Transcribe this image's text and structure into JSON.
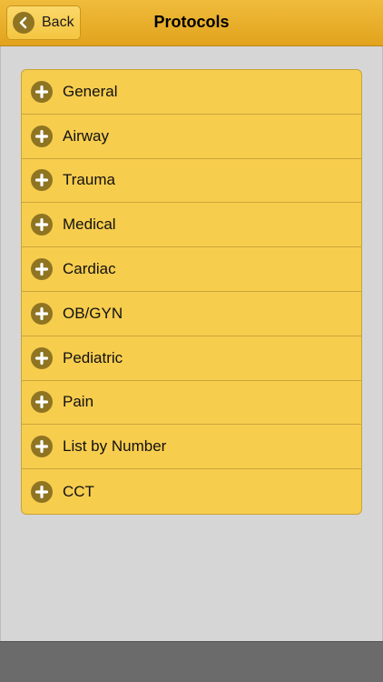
{
  "navbar": {
    "title": "Protocols",
    "back_label": "Back"
  },
  "icons": {
    "back": "chevron-left-icon",
    "row": "plus-circle-icon"
  },
  "colors": {
    "navbar": "#e8ae2a",
    "list_background": "#f7cd4e",
    "icon": "#8f7522",
    "page_background": "#d6d6d6",
    "bottom_bar": "#6b6b6b"
  },
  "protocols": {
    "items": [
      {
        "label": "General"
      },
      {
        "label": "Airway"
      },
      {
        "label": "Trauma"
      },
      {
        "label": "Medical"
      },
      {
        "label": "Cardiac"
      },
      {
        "label": "OB/GYN"
      },
      {
        "label": "Pediatric"
      },
      {
        "label": "Pain"
      },
      {
        "label": "List by Number"
      },
      {
        "label": "CCT"
      }
    ]
  }
}
